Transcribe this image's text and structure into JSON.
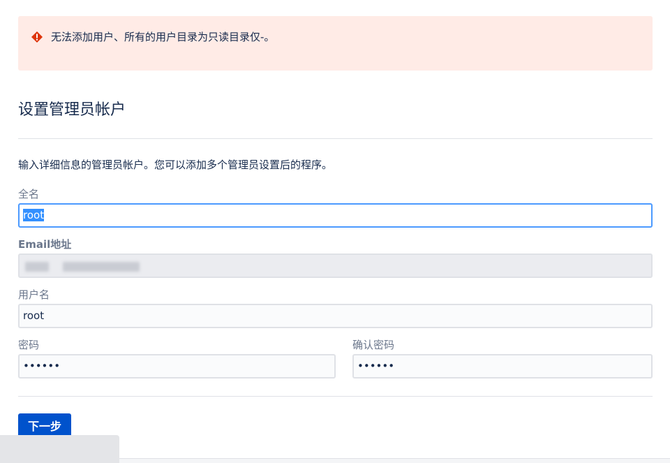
{
  "alert": {
    "message": "无法添加用户、所有的用户目录为只读目录仅-。",
    "icon": "error-icon",
    "color": "#de350b"
  },
  "page_title": "设置管理员帐户",
  "description": "输入详细信息的管理员帐户。您可以添加多个管理员设置后的程序。",
  "fields": {
    "full_name": {
      "label": "全名",
      "value": "root"
    },
    "email": {
      "label": "Email地址",
      "value": ""
    },
    "username": {
      "label": "用户名",
      "value": "root"
    },
    "password": {
      "label": "密码",
      "value": "••••••"
    },
    "confirm_password": {
      "label": "确认密码",
      "value": "••••••"
    }
  },
  "next_button": {
    "label": "下一步"
  },
  "colors": {
    "primary": "#0052cc",
    "alert_background": "#ffebe6",
    "focus_border": "#4c9aff"
  }
}
